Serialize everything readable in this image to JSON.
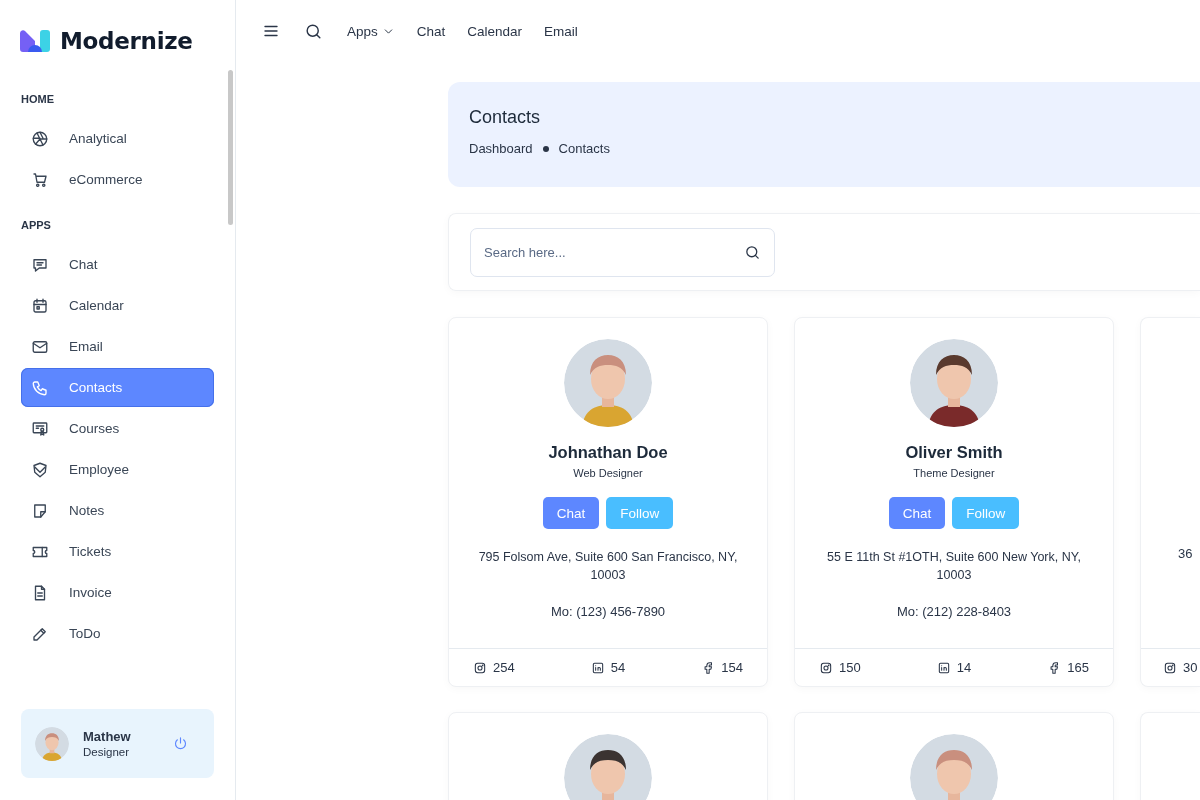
{
  "brand": {
    "name": "Modernize"
  },
  "sidebar": {
    "sections": [
      {
        "heading": "HOME",
        "items": [
          {
            "label": "Analytical",
            "selected": false
          },
          {
            "label": "eCommerce",
            "selected": false
          }
        ]
      },
      {
        "heading": "APPS",
        "items": [
          {
            "label": "Chat",
            "selected": false
          },
          {
            "label": "Calendar",
            "selected": false
          },
          {
            "label": "Email",
            "selected": false
          },
          {
            "label": "Contacts",
            "selected": true
          },
          {
            "label": "Courses",
            "selected": false
          },
          {
            "label": "Employee",
            "selected": false
          },
          {
            "label": "Notes",
            "selected": false
          },
          {
            "label": "Tickets",
            "selected": false
          },
          {
            "label": "Invoice",
            "selected": false
          },
          {
            "label": "ToDo",
            "selected": false
          }
        ]
      }
    ]
  },
  "profile": {
    "name": "Mathew",
    "role": "Designer"
  },
  "topbar": {
    "links": [
      {
        "label": "Apps",
        "kind": "dropdown"
      },
      {
        "label": "Chat",
        "kind": "link"
      },
      {
        "label": "Calendar",
        "kind": "link"
      },
      {
        "label": "Email",
        "kind": "link"
      }
    ]
  },
  "header": {
    "title": "Contacts",
    "breadcrumb": [
      "Dashboard",
      "Contacts"
    ]
  },
  "search": {
    "placeholder": "Search here..."
  },
  "contacts": [
    {
      "kind": "full",
      "name": "Johnathan Doe",
      "role": "Web Designer",
      "chat": "Chat",
      "follow": "Follow",
      "address": "795 Folsom Ave, Suite 600 San Francisco, NY, 10003",
      "phone": "Mo: (123) 456-7890",
      "instagram": "254",
      "linkedin": "54",
      "facebook": "154"
    },
    {
      "kind": "full",
      "name": "Oliver Smith",
      "role": "Theme Designer",
      "chat": "Chat",
      "follow": "Follow",
      "address": "55 E 11th St #1OTH, Suite 600 New York, NY, 10003",
      "phone": "Mo: (212) 228-8403",
      "instagram": "150",
      "linkedin": "14",
      "facebook": "165"
    },
    {
      "kind": "partial",
      "address": "36",
      "instagram": "30"
    },
    {
      "kind": "avatar"
    },
    {
      "kind": "avatar"
    },
    {
      "kind": "empty"
    }
  ]
}
